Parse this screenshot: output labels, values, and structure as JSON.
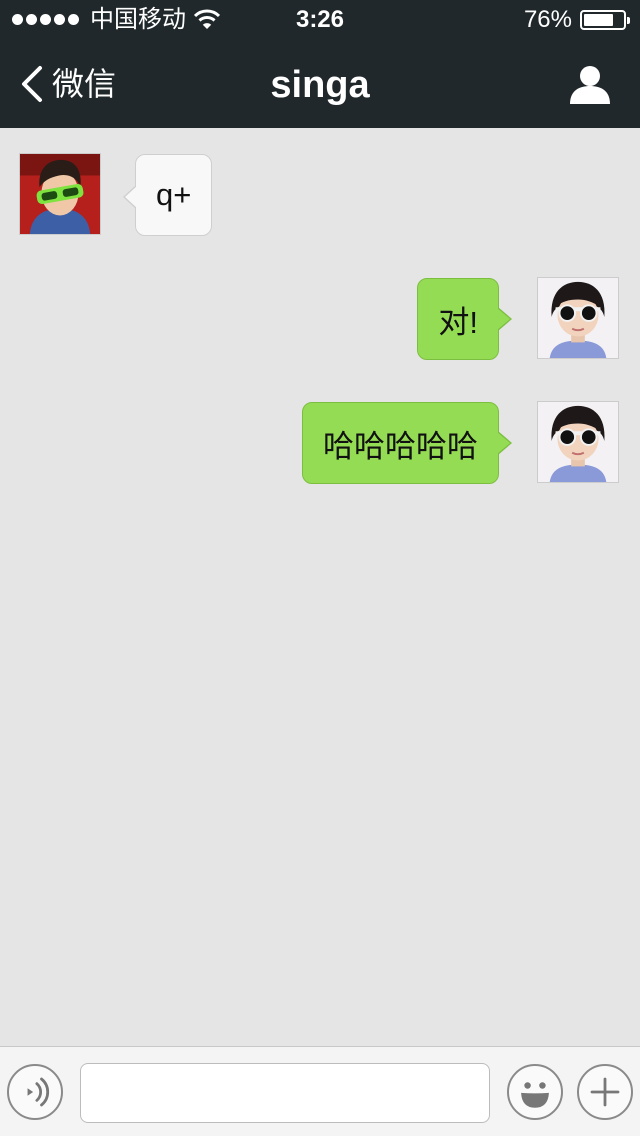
{
  "status_bar": {
    "carrier": "中国移动",
    "time": "3:26",
    "battery_percent": "76%",
    "battery_level": 0.76,
    "signal_dots": 5
  },
  "nav": {
    "back_label": "微信",
    "title": "singa",
    "profile_icon": "person-icon"
  },
  "messages": [
    {
      "direction": "incoming",
      "text": "q+"
    },
    {
      "direction": "outgoing",
      "text": "对!"
    },
    {
      "direction": "outgoing",
      "text": "哈哈哈哈哈"
    }
  ],
  "input_bar": {
    "voice_icon": "voice-icon",
    "text_value": "",
    "emoji_icon": "smiley-icon",
    "more_icon": "plus-icon"
  },
  "colors": {
    "bar_background": "#20282b",
    "chat_background": "#e5e5e5",
    "outgoing_bubble": "#95dc55",
    "incoming_bubble": "#f8f8f8"
  }
}
